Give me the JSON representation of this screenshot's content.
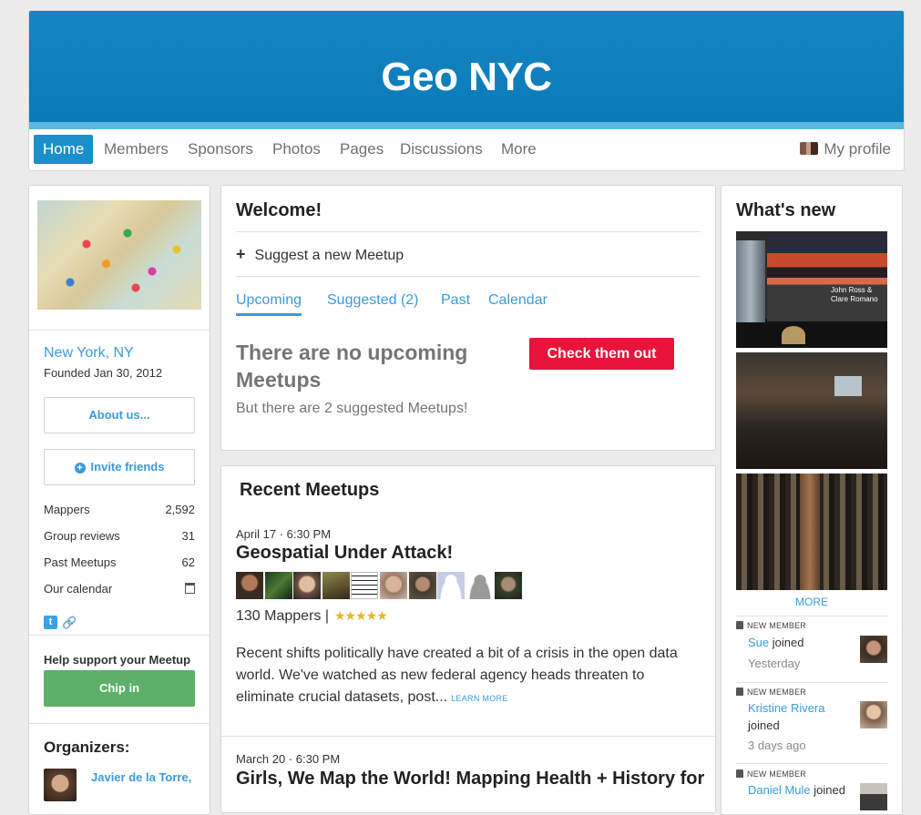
{
  "group": {
    "name": "Geo NYC"
  },
  "nav": {
    "items": [
      "Home",
      "Members",
      "Sponsors",
      "Photos",
      "Pages",
      "Discussions",
      "More"
    ],
    "profile": "My profile"
  },
  "sidebar": {
    "city": "New York, NY",
    "founded": "Founded Jan 30, 2012",
    "about": "About us...",
    "invite": "Invite friends",
    "stats": [
      {
        "label": "Mappers",
        "value": "2,592"
      },
      {
        "label": "Group reviews",
        "value": "31"
      },
      {
        "label": "Past Meetups",
        "value": "62"
      },
      {
        "label": "Our calendar",
        "value": ""
      }
    ],
    "help": "Help support your Meetup",
    "chip": "Chip in",
    "organizers_title": "Organizers:",
    "organizer": "Javier de la Torre,"
  },
  "welcome": {
    "title": "Welcome!",
    "suggest": "Suggest a new Meetup",
    "tabs": [
      "Upcoming",
      "Suggested (2)",
      "Past",
      "Calendar"
    ],
    "empty_title": "There are no upcoming Meetups",
    "check_btn": "Check them out",
    "empty_sub": "But there are 2 suggested Meetups!"
  },
  "recent": {
    "title": "Recent Meetups",
    "meetups": [
      {
        "date": "April 17 · 6:30 PM",
        "title": "Geospatial Under Attack!",
        "mappers": "130 Mappers |",
        "stars": "★★★★★",
        "desc": "Recent shifts politically have created a bit of a crisis in the open data world. We've watched as new federal agency heads threaten to eliminate crucial datasets, post...",
        "learn": "LEARN MORE"
      },
      {
        "date": "March 20 · 6:30 PM",
        "title": "Girls, We Map the World! Mapping Health + History for"
      }
    ]
  },
  "whatsnew": {
    "title": "What's new",
    "more": "MORE",
    "photo1_caption": "John Ross & Clare Romano",
    "label": "NEW MEMBER",
    "members": [
      {
        "name": "Sue",
        "action": "joined",
        "time": "Yesterday"
      },
      {
        "name": "Kristine Rivera",
        "action": "joined",
        "time": "3 days ago"
      },
      {
        "name": "Daniel Mule",
        "action": "joined",
        "time": ""
      }
    ]
  }
}
